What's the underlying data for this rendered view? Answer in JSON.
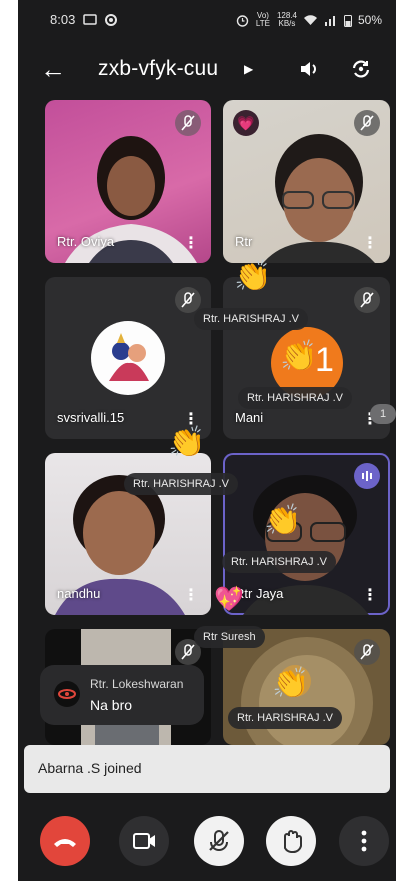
{
  "status": {
    "time": "8:03",
    "net_top": "128.4",
    "net_bottom": "KB/s",
    "volte": "Vo) LTE",
    "battery": "50%"
  },
  "meeting": {
    "code": "zxb-vfyk-cuu"
  },
  "tiles": [
    {
      "name": "Rtr. Oviya"
    },
    {
      "name": "Rtr"
    },
    {
      "name": "svsrivalli.15"
    },
    {
      "name": "Mani"
    },
    {
      "name": "nandhu"
    },
    {
      "name": "Rtr Jaya"
    }
  ],
  "reactions": {
    "chip1": "Rtr. HARISHRAJ .V",
    "chip2": "Rtr. HARISHRAJ .V",
    "chip3": "Rtr. HARISHRAJ .V",
    "chip4": "Rtr. HARISHRAJ .V",
    "chip5": "Rtr. HARISHRAJ .V",
    "chip_suresh": "Rtr Suresh",
    "mani_count": "1",
    "emoji_clap": "👏",
    "emoji_heart": "💖"
  },
  "side_badge": "1",
  "chat": {
    "sender": "Rtr. Lokeshwaran",
    "message": "Na bro"
  },
  "toast": {
    "text": "Abarna .S joined"
  },
  "colors": {
    "end_call": "#e2463b",
    "speaking_border": "#6c63c9",
    "mani_ring": "#f07a1c"
  }
}
